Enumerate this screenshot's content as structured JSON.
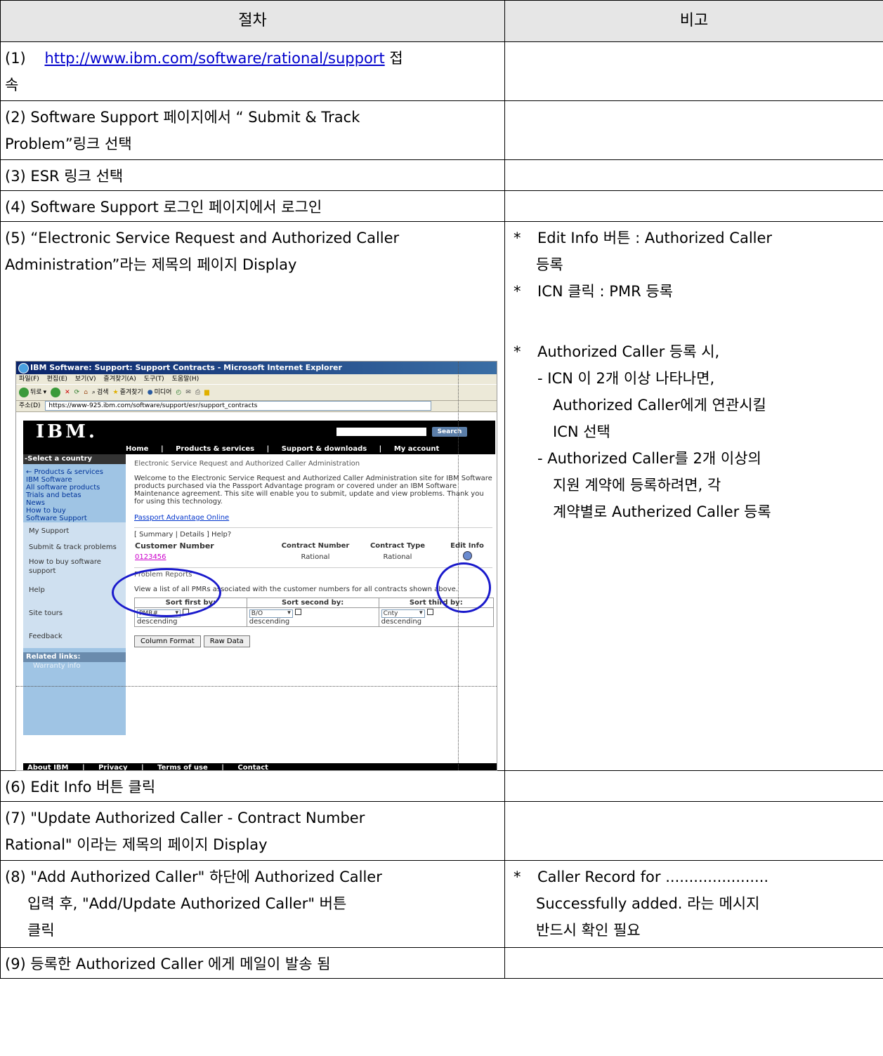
{
  "table": {
    "header_left": "절차",
    "header_right": "비고",
    "rows": [
      {
        "l1a": "(1)",
        "l1link": "http://www.ibm.com/software/rational/support",
        "l1b": "접",
        "l2": "속"
      },
      {
        "line1": "(2) Software Support 페이지에서 “ Submit & Track",
        "line2": "Problem”링크 선택"
      },
      {
        "line1": "(3) ESR 링크 선택"
      },
      {
        "line1": "(4) Software Support 로그인 페이지에서 로그인"
      },
      {
        "line1": "(5) “Electronic Service Request and Authorized Caller",
        "line2": "Administration”라는 제목의 페이지 Display"
      },
      {
        "line1": "(6) Edit Info 버튼 클릭"
      },
      {
        "line1": "(7) \"Update Authorized Caller - Contract Number",
        "line2": "Rational\" 이라는 제목의 페이지 Display"
      },
      {
        "line1": "(8) \"Add Authorized Caller\" 하단에 Authorized Caller",
        "line2": "입력 후, \"Add/Update Authorized Caller\" 버튼",
        "line3": "클릭"
      },
      {
        "line1": "(9) 등록한 Authorized Caller 에게 메일이 발송 됨"
      }
    ],
    "notes5": {
      "star": "*",
      "a1": "Edit Info 버튼 : Authorized Caller",
      "a2": "등록",
      "b1": "ICN 클릭 : PMR 등록",
      "c1": "Authorized Caller 등록 시,",
      "c2": "- ICN 이 2개 이상 나타나면,",
      "c3": "Authorized Caller에게 연관시킬",
      "c4": "ICN 선택",
      "c5": "- Authorized Caller를 2개 이상의",
      "c6": "지원 계약에 등록하려면, 각",
      "c7": "계약별로 Autherized Caller 등록"
    },
    "notes8": {
      "star": "*",
      "a1": "Caller Record for ......................",
      "a2": "Successfully added. 라는 메시지",
      "a3": "반드시 확인 필요"
    }
  },
  "shot": {
    "window_title": "IBM Software: Support: Support Contracts - Microsoft Internet Explorer",
    "menu": [
      "파일(F)",
      "편집(E)",
      "보기(V)",
      "즐겨찾기(A)",
      "도구(T)",
      "도움말(H)"
    ],
    "toolbar": {
      "back": "뒤로",
      "search": "검색",
      "favorites": "즐겨찾기",
      "media": "미디어"
    },
    "address_label": "주소(D)",
    "address": "https://www-925.ibm.com/software/support/esr/support_contracts",
    "logo": "IBM.",
    "search_btn": "Search",
    "nav": [
      "Home",
      "|",
      "Products & services",
      "|",
      "Support & downloads",
      "|",
      "My account"
    ],
    "side": {
      "country": "-Select a country",
      "items": [
        "← Products & services",
        "IBM Software",
        "All software products",
        "Trials and betas",
        "News",
        "How to buy",
        "Software Support"
      ],
      "light": [
        "My Support",
        "Submit & track problems",
        "How to buy software support",
        "Help",
        "Site tours",
        "Feedback"
      ],
      "related": "Related links:",
      "warranty": "Warranty info"
    },
    "content": {
      "heading": "Electronic Service Request and Authorized Caller Administration",
      "welcome": "Welcome to the Electronic Service Request and Authorized Caller Administration site for IBM Software products purchased via the Passport Advantage program or covered under an IBM Software Maintenance agreement. This site will enable you to submit, update and view problems. Thank you for using this technology.",
      "pa_link": "Passport Advantage Online",
      "summary": "[ Summary | Details ] Help?",
      "col_customer": "Customer Number",
      "col_contract_number": "Contract Number",
      "col_contract_type": "Contract Type",
      "col_edit": "Edit Info",
      "customer_number": "0123456",
      "contract_number": "Rational",
      "contract_type": "Rational",
      "problem_reports": "Problem Reports",
      "problem_text": "View a list of all PMRs associated with the customer numbers for all contracts shown above.",
      "sort1": "Sort first by:",
      "sort2": "Sort second by:",
      "sort3": "Sort third by:",
      "sel1": "PMR#",
      "sel2": "B/O",
      "sel3": "Cnty",
      "desc": "descending",
      "btn_column": "Column Format",
      "btn_raw": "Raw Data"
    },
    "footer": [
      "About IBM",
      "|",
      "Privacy",
      "|",
      "Terms of use",
      "|",
      "Contact"
    ]
  }
}
